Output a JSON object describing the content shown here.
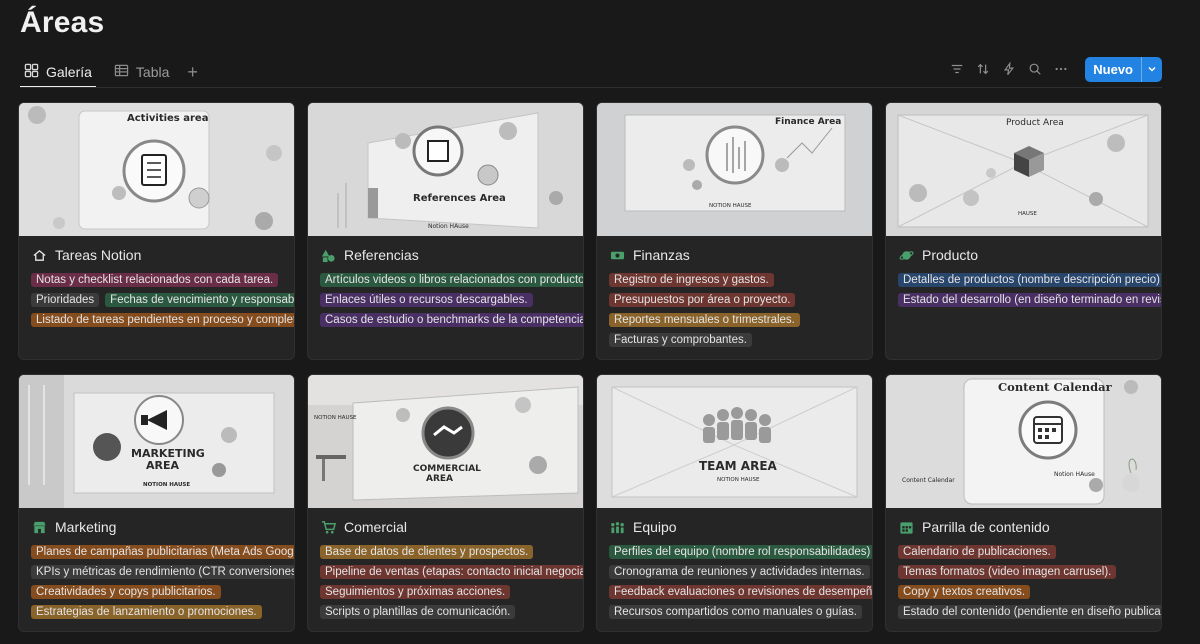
{
  "page": {
    "title": "Áreas"
  },
  "tabs": [
    {
      "label": "Galería",
      "icon": "gallery-icon",
      "active": true
    },
    {
      "label": "Tabla",
      "icon": "table-icon",
      "active": false
    }
  ],
  "toolbar": {
    "icons": [
      "filter-icon",
      "sort-icon",
      "lightning-icon",
      "search-icon",
      "more-icon"
    ],
    "new_label": "Nuevo"
  },
  "colors": {
    "accent": "#2383e2",
    "background": "#191919",
    "card": "#252525"
  },
  "cards": [
    {
      "title": "Tareas Notion",
      "icon": "home-icon",
      "cover_text": [
        "Activities area"
      ],
      "lines": [
        [
          {
            "text": "Notas y checklist relacionados con cada tarea.",
            "color": "pink"
          }
        ],
        [
          {
            "text": "Prioridades",
            "color": "gray"
          },
          {
            "text": "Fechas de vencimiento y responsables",
            "color": "green"
          }
        ],
        [
          {
            "text": "Listado de tareas pendientes en proceso y completadas",
            "color": "orange"
          }
        ]
      ]
    },
    {
      "title": "Referencias",
      "icon": "shapes-icon",
      "cover_text": [
        "References Area",
        "Notion HAuse"
      ],
      "lines": [
        [
          {
            "text": "Artículos videos o libros relacionados con productos",
            "color": "green"
          }
        ],
        [
          {
            "text": "Enlaces útiles o recursos descargables.",
            "color": "purple"
          }
        ],
        [
          {
            "text": "Casos de estudio o benchmarks de la competencia",
            "color": "purple"
          }
        ]
      ]
    },
    {
      "title": "Finanzas",
      "icon": "money-icon",
      "cover_text": [
        "Finance Area",
        "NOTION HAUSE"
      ],
      "lines": [
        [
          {
            "text": "Registro de ingresos y gastos.",
            "color": "red"
          }
        ],
        [
          {
            "text": "Presupuestos por área o proyecto.",
            "color": "red"
          }
        ],
        [
          {
            "text": "Reportes mensuales o trimestrales.",
            "color": "brown"
          }
        ],
        [
          {
            "text": "Facturas y comprobantes.",
            "color": "gray"
          }
        ]
      ]
    },
    {
      "title": "Producto",
      "icon": "planet-icon",
      "cover_text": [
        "Product Area",
        "HAUSE"
      ],
      "lines": [
        [
          {
            "text": "Detalles de productos (nombre descripción precio)",
            "color": "blue"
          }
        ],
        [
          {
            "text": "Estado del desarrollo (en diseño terminado en revisión)",
            "color": "purple"
          }
        ]
      ]
    },
    {
      "title": "Marketing",
      "icon": "store-icon",
      "cover_text": [
        "MARKETING",
        "AREA",
        "NOTION HAUSE"
      ],
      "lines": [
        [
          {
            "text": "Planes de campañas publicitarias (Meta Ads Google)",
            "color": "orange"
          }
        ],
        [
          {
            "text": "KPIs y métricas de rendimiento (CTR conversiones)",
            "color": "gray"
          }
        ],
        [
          {
            "text": "Creatividades y copys publicitarios.",
            "color": "orange"
          }
        ],
        [
          {
            "text": "Estrategias de lanzamiento o promociones.",
            "color": "brown"
          }
        ]
      ]
    },
    {
      "title": "Comercial",
      "icon": "cart-icon",
      "cover_text": [
        "COMMERCIAL",
        "AREA",
        "NOTION HAUSE"
      ],
      "lines": [
        [
          {
            "text": "Base de datos de clientes y prospectos.",
            "color": "brown"
          }
        ],
        [
          {
            "text": "Pipeline de ventas (etapas: contacto inicial negociación)",
            "color": "red"
          }
        ],
        [
          {
            "text": "Seguimientos y próximas acciones.",
            "color": "red"
          }
        ],
        [
          {
            "text": "Scripts o plantillas de comunicación.",
            "color": "gray"
          }
        ]
      ]
    },
    {
      "title": "Equipo",
      "icon": "people-icon",
      "cover_text": [
        "TEAM AREA",
        "NOTION HAUSE"
      ],
      "lines": [
        [
          {
            "text": "Perfiles del equipo (nombre rol responsabilidades)",
            "color": "green"
          }
        ],
        [
          {
            "text": "Cronograma de reuniones y actividades internas.",
            "color": "gray"
          }
        ],
        [
          {
            "text": "Feedback evaluaciones o revisiones de desempeño",
            "color": "red"
          }
        ],
        [
          {
            "text": "Recursos compartidos como manuales o guías.",
            "color": "gray"
          }
        ]
      ]
    },
    {
      "title": "Parrilla de contenido",
      "icon": "calendar-icon",
      "cover_text": [
        "Content Calendar",
        "Content Calendar",
        "Notion HAuse"
      ],
      "lines": [
        [
          {
            "text": "Calendario de publicaciones.",
            "color": "red"
          }
        ],
        [
          {
            "text": "Temas formatos (video imagen carrusel).",
            "color": "red"
          }
        ],
        [
          {
            "text": "Copy y textos creativos.",
            "color": "orange"
          }
        ],
        [
          {
            "text": "Estado del contenido (pendiente en diseño publicado)",
            "color": "gray"
          }
        ]
      ]
    }
  ]
}
